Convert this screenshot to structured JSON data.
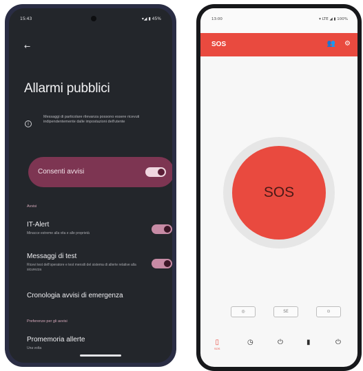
{
  "phone1": {
    "status": {
      "time": "15:43",
      "indicators": "▾◢ ▮ 45%"
    },
    "back_icon": "←",
    "title": "Allarmi pubblici",
    "info_icon": "i",
    "info_text": "Messaggi di particolare rilevanza possono essere ricevuti indipendentemente dalle impostazioni dell'utente",
    "consent": {
      "label": "Consenti avvisi",
      "on": true
    },
    "section_avvisi": "Avvisi",
    "items": [
      {
        "title": "IT-Alert",
        "subtitle": "Minacce estreme alla vita e alle proprietà",
        "on": true
      },
      {
        "title": "Messaggi di test",
        "subtitle": "Ricevi test dell'operatore e test mensili del sistema di allerte relative alla sicurezza",
        "on": true
      },
      {
        "title": "Cronologia avvisi di emergenza"
      }
    ],
    "section_pref": "Preferenze per gli avvisi",
    "reminder": {
      "title": "Promemoria allerte",
      "subtitle": "Una volta"
    }
  },
  "phone2": {
    "status": {
      "time": "13:00",
      "indicators": "▾ LTE ◢ ▮ 100%"
    },
    "appbar": {
      "title": "SOS",
      "contacts_icon": "👥",
      "settings_icon": "⚙"
    },
    "sos_label": "SOS",
    "small_buttons": [
      "◎",
      "SE",
      "⊙"
    ],
    "nav": [
      {
        "icon": "▯",
        "caption": "SOS",
        "active": true
      },
      {
        "icon": "◷",
        "active": false
      },
      {
        "icon": "⏻",
        "active": false
      },
      {
        "icon": "▮",
        "active": false
      },
      {
        "icon": "⏻",
        "active": false
      }
    ]
  },
  "colors": {
    "phone1_bg": "#23262b",
    "consent_card": "#7d3552",
    "accent_red": "#e94a3f"
  }
}
